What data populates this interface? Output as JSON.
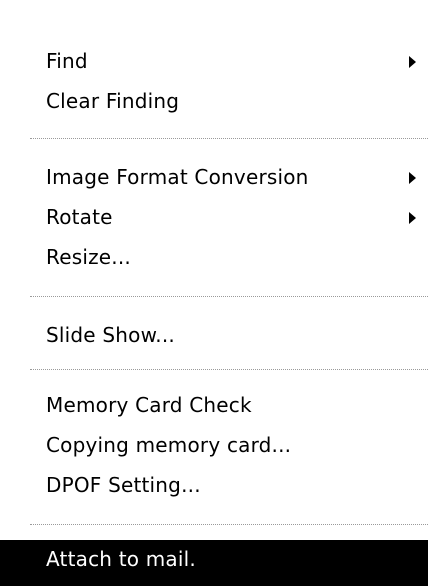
{
  "menu": {
    "items": [
      {
        "label": "Find",
        "has_submenu": true
      },
      {
        "label": "Clear Finding",
        "has_submenu": false
      },
      {
        "label": "Image Format Conversion",
        "has_submenu": true
      },
      {
        "label": "Rotate",
        "has_submenu": true
      },
      {
        "label": "Resize...",
        "has_submenu": false
      },
      {
        "label": "Slide Show...",
        "has_submenu": false
      },
      {
        "label": "Memory Card Check",
        "has_submenu": false
      },
      {
        "label": "Copying memory card...",
        "has_submenu": false
      },
      {
        "label": "DPOF Setting...",
        "has_submenu": false
      },
      {
        "label": "Attach to mail.",
        "has_submenu": false,
        "highlighted": true
      }
    ],
    "colors": {
      "highlight_bg": "#000000",
      "highlight_text": "#ffffff",
      "separator": "#9a9a9a"
    },
    "icons": {
      "submenu_arrow": "triangle-right-icon"
    }
  }
}
